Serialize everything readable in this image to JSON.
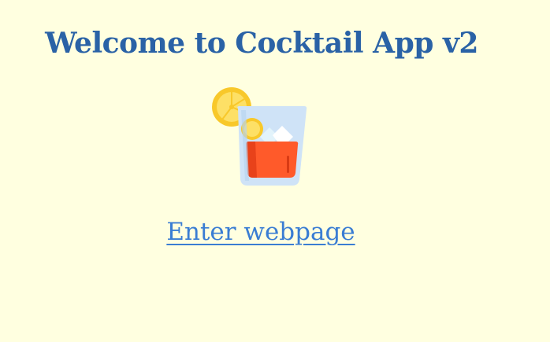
{
  "page": {
    "title": "Welcome to Cocktail App v2",
    "logo_icon": "cocktail-glass-icon",
    "enter_link_label": "Enter webpage"
  },
  "colors": {
    "background": "#ffffe0",
    "title": "#2a62a6",
    "link": "#3a7dd3"
  }
}
